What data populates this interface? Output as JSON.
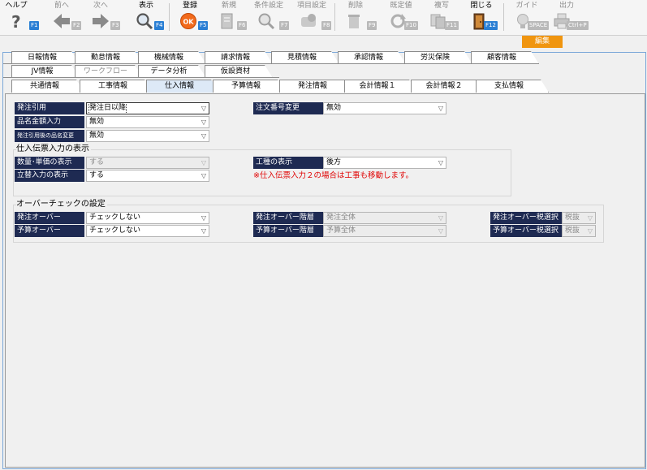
{
  "toolbar": {
    "buttons": [
      {
        "label": "ヘルプ",
        "key": "F1"
      },
      {
        "label": "前へ",
        "key": "F2"
      },
      {
        "label": "次へ",
        "key": "F3"
      },
      {
        "label": "表示",
        "key": "F4"
      },
      {
        "label": "登録",
        "key": "F5"
      },
      {
        "label": "新規",
        "key": "F6"
      },
      {
        "label": "条件設定",
        "key": "F7"
      },
      {
        "label": "項目設定",
        "key": "F8"
      },
      {
        "label": "削除",
        "key": "F9"
      },
      {
        "label": "既定値",
        "key": "F10"
      },
      {
        "label": "複写",
        "key": "F11"
      },
      {
        "label": "閉じる",
        "key": "F12"
      },
      {
        "label": "ガイド",
        "key": "SPACE"
      },
      {
        "label": "出力",
        "key": "Ctrl+P"
      }
    ],
    "mode_badge": "編集"
  },
  "tabs": {
    "row1": [
      "日報情報",
      "勤怠情報",
      "機械情報",
      "請求情報",
      "見積情報",
      "承認情報",
      "労災保険",
      "顧客情報"
    ],
    "row2": [
      "JV情報",
      "ワークフロー",
      "データ分析",
      "仮設資材"
    ],
    "row3": [
      "共通情報",
      "工事情報",
      "仕入情報",
      "予算情報",
      "発注情報",
      "会計情報１",
      "会計情報２",
      "支払情報"
    ],
    "active": "仕入情報"
  },
  "form": {
    "order_ref": {
      "label": "発注引用",
      "value": "発注日以降"
    },
    "order_no_change": {
      "label": "注文番号変更",
      "value": "無効"
    },
    "item_amount_input": {
      "label": "品名金額入力",
      "value": "無効"
    },
    "item_name_change_after_ref": {
      "label": "発注引用後の品名変更",
      "value": "無効"
    },
    "purchase_slip_display": {
      "title": "仕入伝票入力の表示",
      "qty_price": {
        "label": "数量･単価の表示",
        "value": "する"
      },
      "advance_input": {
        "label": "立替入力の表示",
        "value": "する"
      },
      "work_type": {
        "label": "工種の表示",
        "value": "後方"
      },
      "note": "※仕入伝票入力２の場合は工事も移動します。"
    },
    "over_check": {
      "title": "オーバーチェックの設定",
      "order_over": {
        "label": "発注オーバー",
        "value": "チェックしない"
      },
      "budget_over": {
        "label": "予算オーバー",
        "value": "チェックしない"
      },
      "order_over_level": {
        "label": "発注オーバー階層",
        "value": "発注全体"
      },
      "budget_over_level": {
        "label": "予算オーバー階層",
        "value": "予算全体"
      },
      "order_over_tax": {
        "label": "発注オーバー税選択",
        "value": "税抜"
      },
      "budget_over_tax": {
        "label": "予算オーバー税選択",
        "value": "税抜"
      }
    }
  }
}
